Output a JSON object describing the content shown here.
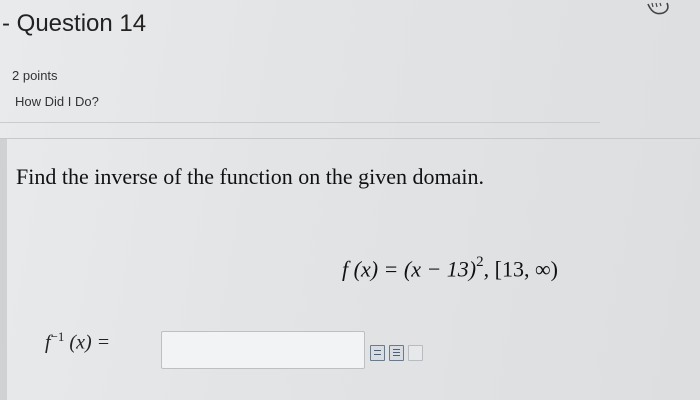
{
  "question": {
    "title": "- Question 14",
    "points": "2 points",
    "feedback_link": "How Did I Do?"
  },
  "problem": {
    "prompt": "Find the inverse of the function on the given domain.",
    "function_label": "f (x) = (x − 13)",
    "exponent": "2",
    "domain": ", [13, ∞)"
  },
  "answer": {
    "label_base": "f",
    "label_exp": "−1",
    "label_arg": " (x) =",
    "value": "",
    "placeholder": ""
  },
  "toolbar": {
    "icons": [
      "equation-editor-icon",
      "formula-icon",
      "help-icon"
    ]
  },
  "colors": {
    "background": "#e4e6e8",
    "text": "#111111",
    "input_border": "#bdbfc1"
  }
}
